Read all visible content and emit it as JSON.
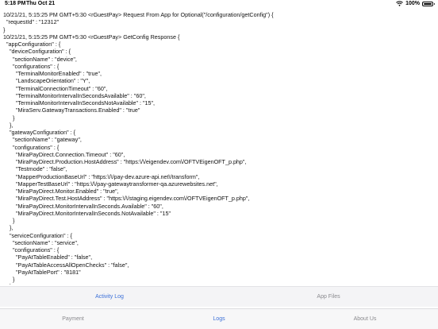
{
  "status_bar": {
    "time": "5:18 PM",
    "date": "Thu Oct 21",
    "battery_percent": "100%",
    "battery_level": 1.0
  },
  "log_lines": [
    "10/21/21, 5:15:25 PM GMT+5:30 <rGuestPay> Request From App for Optional(\"/configuration/getConfig\") {",
    "  \"requestId\" : \"12312\"",
    "}",
    "10/21/21, 5:15:25 PM GMT+5:30 <rGuestPay> GetConfig Response {",
    "  \"appConfiguration\" : {",
    "    \"deviceConfiguration\" : {",
    "      \"sectionName\" : \"device\",",
    "      \"configurations\" : {",
    "        \"TerminalMonitorEnabled\" : \"true\",",
    "        \"LandscapeOrientation\" : \"Y\",",
    "        \"TerminalConnectionTimeout\" : \"60\",",
    "        \"TerminalMonitorIntervalInSecondsAvailable\" : \"60\",",
    "        \"TerminalMonitorIntervalInSecondsNotAvailable\" : \"15\",",
    "        \"MiraServ.GatewayTransactions.Enabled\" : \"true\"",
    "      }",
    "    },",
    "    \"gatewayConfiguration\" : {",
    "      \"sectionName\" : \"gateway\",",
    "      \"configurations\" : {",
    "        \"MiraPayDirect.Connection.Timeout\" : \"60\",",
    "        \"MiraPayDirect.Production.HostAddress\" : \"https:\\/\\/eigendev.com\\/OFTVEigenOFT_p.php\",",
    "        \"Testmode\" : \"false\",",
    "        \"MapperProductionBaseUrl\" : \"https:\\/\\/pay-dev.azure-api.net\\/transform\",",
    "        \"MapperTestBaseUrl\" : \"https:\\/\\/pay-gatewaytransformer-qa.azurewebsites.net\",",
    "        \"MiraPayDirect.Monitor.Enabled\" : \"true\",",
    "        \"MiraPayDirect.Test.HostAddress\" : \"https:\\/\\/staging.eigendev.com\\/OFTVEigenOFT_p.php\",",
    "        \"MiraPayDirect.MonitorIntervalInSeconds.Available\" : \"60\",",
    "        \"MiraPayDirect.MonitorIntervalInSeconds.NotAvailable\" : \"15\"",
    "      }",
    "    },",
    "    \"serviceConfiguration\" : {",
    "      \"sectionName\" : \"service\",",
    "      \"configurations\" : {",
    "        \"PayAtTableEnabled\" : \"false\",",
    "        \"PayAtTableAccessAllOpenChecks\" : \"false\",",
    "        \"PayAtTablePort\" : \"8181\"",
    "      }",
    "    }"
  ],
  "segments": [
    {
      "label": "Activity Log",
      "active": true
    },
    {
      "label": "App Files",
      "active": false
    }
  ],
  "tabs": [
    {
      "label": "Payment",
      "active": false
    },
    {
      "label": "Logs",
      "active": true
    },
    {
      "label": "About Us",
      "active": false
    }
  ],
  "colors": {
    "accent": "#3a6fd8",
    "inactive": "#8a8a8e"
  }
}
